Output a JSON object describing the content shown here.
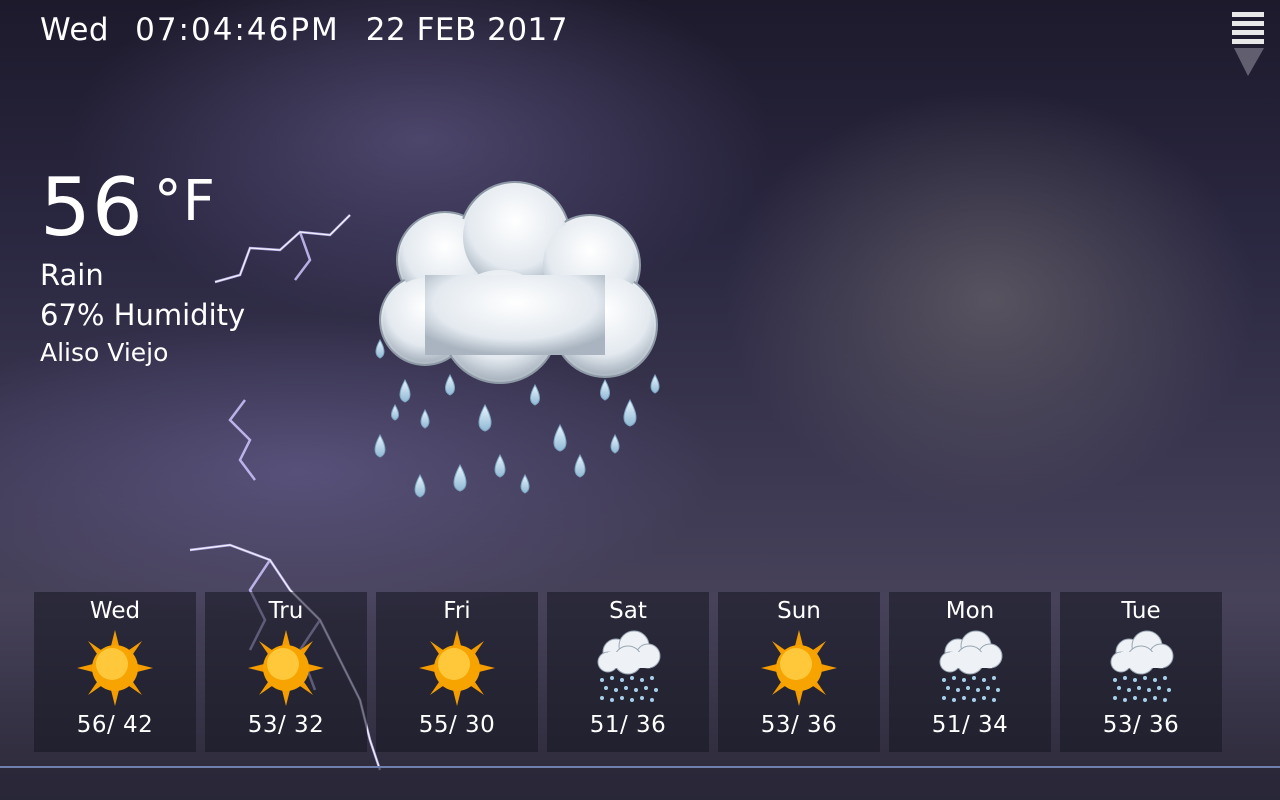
{
  "header": {
    "day": "Wed",
    "time": "07:04:46PM",
    "date": "22 FEB 2017",
    "menu_icon": "hamburger-menu-icon"
  },
  "current": {
    "temperature": "56",
    "unit": "°F",
    "condition": "Rain",
    "humidity": "67% Humidity",
    "location": "Aliso Viejo",
    "icon": "rain-cloud-icon"
  },
  "forecast": [
    {
      "day": "Wed",
      "hilo": "56/ 42",
      "icon": "sun-icon"
    },
    {
      "day": "Tru",
      "hilo": "53/ 32",
      "icon": "sun-icon"
    },
    {
      "day": "Fri",
      "hilo": "55/ 30",
      "icon": "sun-icon"
    },
    {
      "day": "Sat",
      "hilo": "51/ 36",
      "icon": "rain-cloud-icon"
    },
    {
      "day": "Sun",
      "hilo": "53/ 36",
      "icon": "sun-icon"
    },
    {
      "day": "Mon",
      "hilo": "51/ 34",
      "icon": "rain-cloud-icon"
    },
    {
      "day": "Tue",
      "hilo": "53/ 36",
      "icon": "rain-cloud-icon"
    }
  ],
  "colors": {
    "sun": "#f7a400",
    "cloud": "#e9eef3",
    "raindrop": "#b8d8ec"
  }
}
